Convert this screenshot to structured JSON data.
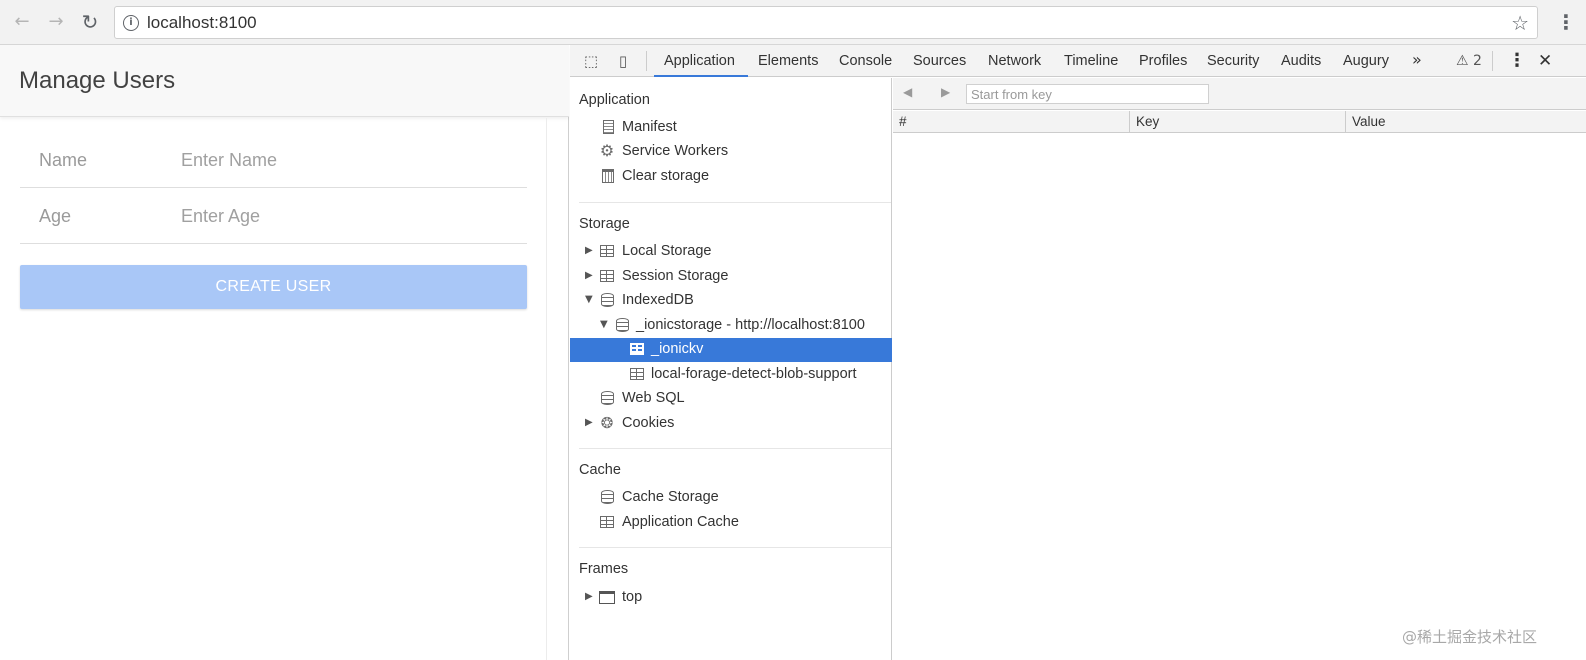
{
  "browser": {
    "back_icon": "←",
    "forward_icon": "→",
    "reload_icon": "↻",
    "url": "localhost:8100",
    "info_icon": "i",
    "star_icon": "☆",
    "menu_icon": "⋮"
  },
  "app": {
    "title": "Manage Users",
    "fields": [
      {
        "label": "Name",
        "placeholder": "Enter Name"
      },
      {
        "label": "Age",
        "placeholder": "Enter Age"
      }
    ],
    "create_button": "CREATE USER",
    "button_color": "#a9c7f7"
  },
  "devtools": {
    "tabs": [
      "Application",
      "Elements",
      "Console",
      "Sources",
      "Network",
      "Timeline",
      "Profiles",
      "Security",
      "Audits",
      "Augury"
    ],
    "active_tab": "Application",
    "more_tabs": "»",
    "warnings": "⚠ 2",
    "menu": "⋮",
    "close": "✕",
    "inspect_icon": "⬚",
    "device_icon": "▯",
    "sidebar": {
      "application": {
        "title": "Application",
        "items": [
          "Manifest",
          "Service Workers",
          "Clear storage"
        ]
      },
      "storage": {
        "title": "Storage",
        "items": [
          "Local Storage",
          "Session Storage",
          "IndexedDB",
          "_ionicstorage - http://localhost:8100",
          "_ionickv",
          "local-forage-detect-blob-support",
          "Web SQL",
          "Cookies"
        ]
      },
      "cache": {
        "title": "Cache",
        "items": [
          "Cache Storage",
          "Application Cache"
        ]
      },
      "frames": {
        "title": "Frames",
        "items": [
          "top"
        ]
      },
      "selected": "_ionickv",
      "selected_color": "#3879d9"
    },
    "main": {
      "back_arrow": "◀",
      "forward_arrow": "▶",
      "start_placeholder": "Start from key",
      "columns": [
        "#",
        "Key",
        "Value"
      ]
    }
  },
  "watermark": "@稀土掘金技术社区"
}
